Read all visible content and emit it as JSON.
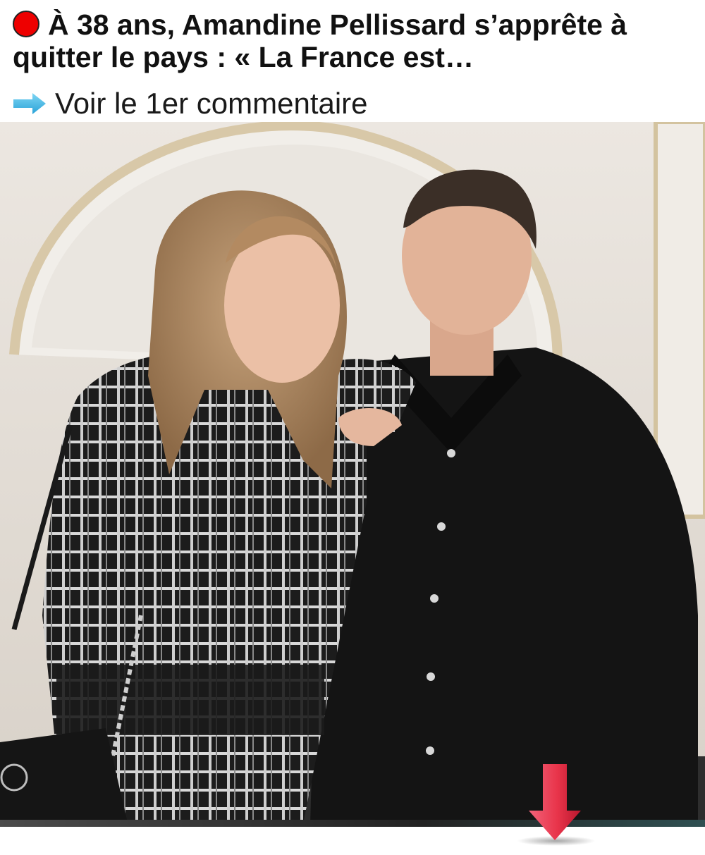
{
  "headline": {
    "text": "À 38 ans, Amandine Pellissard s’apprête à quitter le pays : « La France est…",
    "dot_color": "#ee0000"
  },
  "cta": {
    "icon": "right-arrow-icon",
    "label": "Voir le 1er commentaire",
    "icon_color": "#3fb6e6"
  },
  "photo": {
    "subject": "couple-portrait"
  },
  "down_arrow": {
    "icon": "down-arrow-icon",
    "color": "#e8344a"
  }
}
